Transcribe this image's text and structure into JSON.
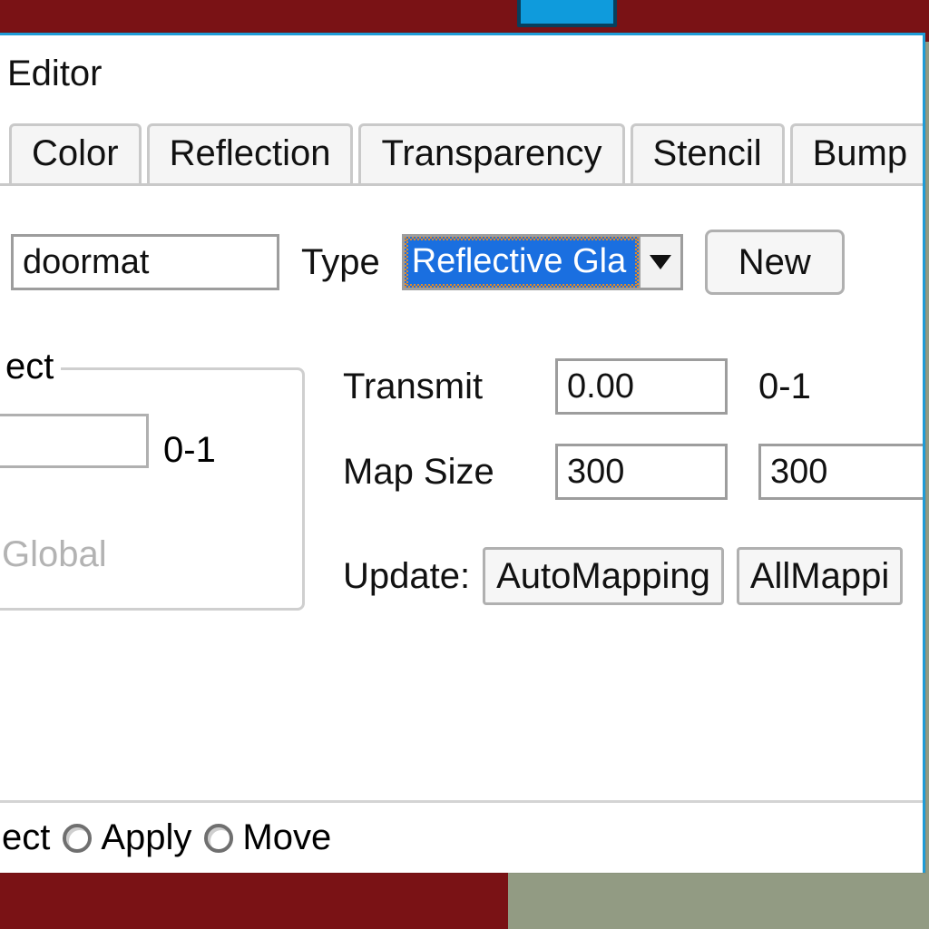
{
  "window": {
    "title": "Editor"
  },
  "tabs": {
    "color": "Color",
    "reflection": "Reflection",
    "transparency": "Transparency",
    "stencil": "Stencil",
    "bump": "Bump"
  },
  "name_field": {
    "value": "doormat"
  },
  "type": {
    "label": "Type",
    "selected": "Reflective Gla"
  },
  "new_button": "New",
  "groupbox": {
    "legend": "ect",
    "range": "0-1",
    "global": "Global"
  },
  "transmit": {
    "label": "Transmit",
    "value": "0.00",
    "hint": "0-1"
  },
  "mapsize": {
    "label": "Map Size",
    "w": "300",
    "h": "300"
  },
  "update": {
    "label": "Update:",
    "auto": "AutoMapping",
    "all": "AllMappi"
  },
  "bottom": {
    "ect": "ect",
    "apply": "Apply",
    "move": "Move"
  }
}
